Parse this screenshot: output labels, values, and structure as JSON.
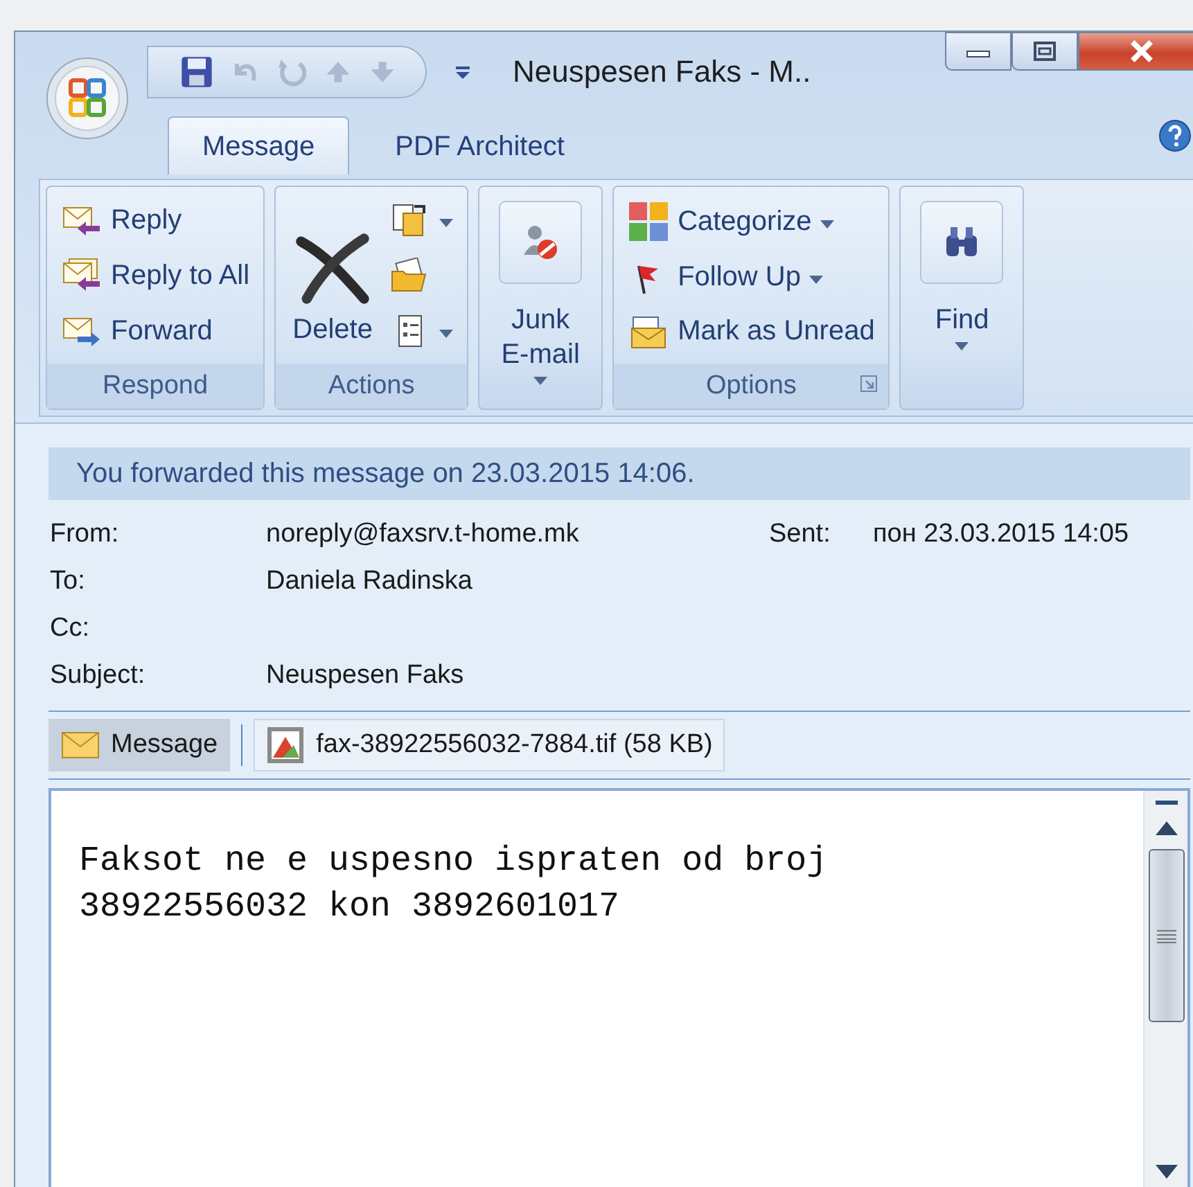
{
  "window": {
    "title": "Neuspesen Faks - M.."
  },
  "tabs": [
    {
      "label": "Message",
      "selected": true
    },
    {
      "label": "PDF Architect",
      "selected": false
    }
  ],
  "ribbon": {
    "groups": [
      {
        "label": "Respond",
        "items": [
          {
            "kind": "small",
            "label": "Reply",
            "dropdown": false
          },
          {
            "kind": "small",
            "label": "Reply to All",
            "dropdown": false
          },
          {
            "kind": "small",
            "label": "Forward",
            "dropdown": false
          }
        ]
      },
      {
        "label": "Actions",
        "items": [
          {
            "kind": "large",
            "label": "Delete",
            "dropdown": false
          },
          {
            "kind": "icon",
            "dropdown": true
          },
          {
            "kind": "icon",
            "dropdown": false
          },
          {
            "kind": "icon",
            "dropdown": true
          }
        ]
      },
      {
        "items": [
          {
            "kind": "large",
            "label": "Junk E-mail",
            "dropdown": true
          }
        ]
      },
      {
        "label": "Options",
        "launcher": true,
        "items": [
          {
            "kind": "small",
            "label": "Categorize",
            "dropdown": true
          },
          {
            "kind": "small",
            "label": "Follow Up",
            "dropdown": true
          },
          {
            "kind": "small",
            "label": "Mark as Unread",
            "dropdown": false
          }
        ]
      },
      {
        "items": [
          {
            "kind": "large",
            "label": "Find",
            "dropdown": true
          }
        ]
      }
    ]
  },
  "info_bar": "You forwarded this message on 23.03.2015 14:06.",
  "header": {
    "from_label": "From:",
    "from": "noreply@faxsrv.t-home.mk",
    "sent_label": "Sent:",
    "sent": "пон 23.03.2015 14:05",
    "fields": [
      {
        "label": "To:",
        "value": "Daniela Radinska"
      },
      {
        "label": "Cc:"
      },
      {
        "label": "Subject:",
        "value": "Neuspesen Faks"
      }
    ]
  },
  "attachments": [
    {
      "kind": "message",
      "label": "Message",
      "selected": true
    },
    {
      "kind": "file",
      "label": "fax-38922556032-7884.tif (58 KB)",
      "selected": false
    }
  ],
  "body": {
    "lines": [
      "Faksot ne e uspesno ispraten od broj",
      "38922556032 kon 3892601017"
    ]
  }
}
